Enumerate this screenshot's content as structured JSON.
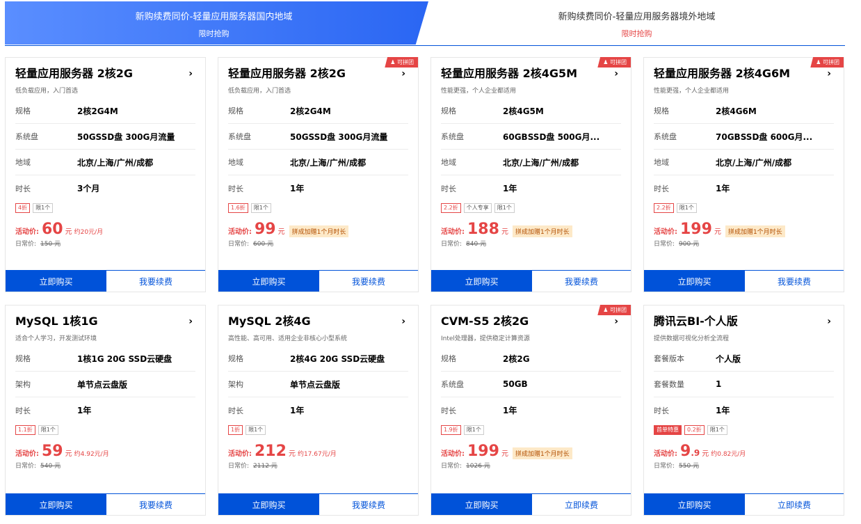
{
  "tabs": [
    {
      "title": "新购续费同价-轻量应用服务器国内地域",
      "sub": "限时抢购"
    },
    {
      "title": "新购续费同价-轻量应用服务器境外地域",
      "sub": "限时抢购"
    }
  ],
  "common": {
    "price_label": "活动价:",
    "unit": "元",
    "normal_label": "日常价:",
    "buy": "立即购买",
    "renew": "我要续费",
    "renew_alt": "立即续费",
    "ribbon": "可拼团",
    "arrow": "›"
  },
  "cards": [
    {
      "title": "轻量应用服务器 2核2G",
      "desc": "低负载应用，入门首选",
      "rows": [
        [
          "规格",
          "2核2G4M"
        ],
        [
          "系统盘",
          "50GSSD盘 300G月流量"
        ],
        [
          "地域",
          "北京/上海/广州/成都"
        ],
        [
          "时长",
          "3个月"
        ]
      ],
      "tags": [
        "4折",
        "限1个"
      ],
      "price_int": "60",
      "price_dec": "",
      "per": "约20元/月",
      "promo": "",
      "normal": "150 元",
      "renew": "我要续费",
      "ribbon": false
    },
    {
      "title": "轻量应用服务器 2核2G",
      "desc": "低负载应用，入门首选",
      "rows": [
        [
          "规格",
          "2核2G4M"
        ],
        [
          "系统盘",
          "50GSSD盘 300G月流量"
        ],
        [
          "地域",
          "北京/上海/广州/成都"
        ],
        [
          "时长",
          "1年"
        ]
      ],
      "tags": [
        "1.6折",
        "限1个"
      ],
      "price_int": "99",
      "price_dec": "",
      "per": "",
      "promo": "拼成加赠1个月时长",
      "normal": "600 元",
      "renew": "我要续费",
      "ribbon": true
    },
    {
      "title": "轻量应用服务器 2核4G5M",
      "desc": "性能更强，个人企业都适用",
      "rows": [
        [
          "规格",
          "2核4G5M"
        ],
        [
          "系统盘",
          "60GBSSD盘 500G月..."
        ],
        [
          "地域",
          "北京/上海/广州/成都"
        ],
        [
          "时长",
          "1年"
        ]
      ],
      "tags": [
        "2.2折",
        "个人专享",
        "限1个"
      ],
      "price_int": "188",
      "price_dec": "",
      "per": "",
      "promo": "拼成加赠1个月时长",
      "normal": "840 元",
      "renew": "我要续费",
      "ribbon": true
    },
    {
      "title": "轻量应用服务器 2核4G6M",
      "desc": "性能更强，个人企业都适用",
      "rows": [
        [
          "规格",
          "2核4G6M"
        ],
        [
          "系统盘",
          "70GBSSD盘 600G月..."
        ],
        [
          "地域",
          "北京/上海/广州/成都"
        ],
        [
          "时长",
          "1年"
        ]
      ],
      "tags": [
        "2.2折",
        "限1个"
      ],
      "price_int": "199",
      "price_dec": "",
      "per": "",
      "promo": "拼成加赠1个月时长",
      "normal": "900 元",
      "renew": "我要续费",
      "ribbon": true
    },
    {
      "title": "MySQL 1核1G",
      "desc": "适合个人学习，开发测试环境",
      "rows": [
        [
          "规格",
          "1核1G 20G SSD云硬盘"
        ],
        [
          "架构",
          "单节点云盘版"
        ],
        [
          "时长",
          "1年"
        ]
      ],
      "tags": [
        "1.1折",
        "限1个"
      ],
      "price_int": "59",
      "price_dec": "",
      "per": "约4.92元/月",
      "promo": "",
      "normal": "540 元",
      "renew": "我要续费",
      "ribbon": false
    },
    {
      "title": "MySQL 2核4G",
      "desc": "高性能、高可用、适用企业非核心小型系统",
      "rows": [
        [
          "规格",
          "2核4G 20G SSD云硬盘"
        ],
        [
          "架构",
          "单节点云盘版"
        ],
        [
          "时长",
          "1年"
        ]
      ],
      "tags": [
        "1折",
        "限1个"
      ],
      "price_int": "212",
      "price_dec": "",
      "per": "约17.67元/月",
      "promo": "",
      "normal": "2112 元",
      "renew": "我要续费",
      "ribbon": false
    },
    {
      "title": "CVM-S5 2核2G",
      "desc": "Intel处理器，提供稳定计算资源",
      "rows": [
        [
          "规格",
          "2核2G"
        ],
        [
          "系统盘",
          "50GB"
        ],
        [
          "时长",
          "1年"
        ]
      ],
      "tags": [
        "1.9折",
        "限1个"
      ],
      "price_int": "199",
      "price_dec": "",
      "per": "",
      "promo": "拼成加赠1个月时长",
      "normal": "1026 元",
      "renew": "立即续费",
      "ribbon": true
    },
    {
      "title": "腾讯云BI-个人版",
      "desc": "提供数据可视化分析全流程",
      "rows": [
        [
          "套餐版本",
          "个人版"
        ],
        [
          "套餐数量",
          "1"
        ],
        [
          "时长",
          "1年"
        ]
      ],
      "tags": [
        "首单特惠",
        "0.2折",
        "限1个"
      ],
      "price_int": "9",
      "price_dec": ".9",
      "per": "约0.82元/月",
      "promo": "",
      "normal": "550 元",
      "renew": "立即续费",
      "ribbon": false
    }
  ]
}
